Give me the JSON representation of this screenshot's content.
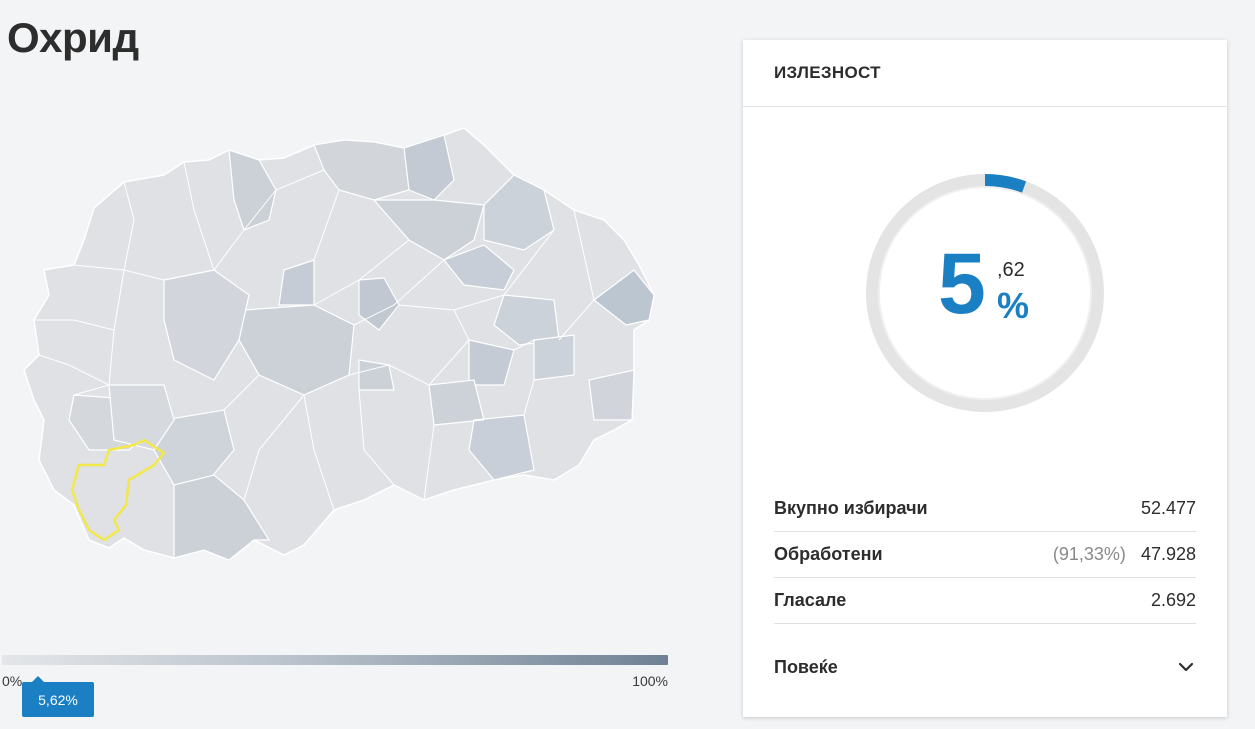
{
  "page": {
    "title": "Охрид"
  },
  "legend": {
    "min_label": "0%",
    "max_label": "100%",
    "marker_label": "5,62%",
    "marker_value_percent": 5.62,
    "gradient_colors": [
      "#e4e6e9",
      "#b8c1cb",
      "#6f8194"
    ]
  },
  "turnout_card": {
    "header": "ИЗЛЕЗНОСТ",
    "gauge": {
      "integer_part": "5",
      "decimal_part": ",62",
      "percent_sign": "%",
      "value_percent": 5.62,
      "accent_color": "#1b7fc3",
      "track_color": "#e4e4e4"
    },
    "stats": [
      {
        "label": "Вкупно избирачи",
        "pct": "",
        "value": "52.477"
      },
      {
        "label": "Обработени",
        "pct": "(91,33%)",
        "value": "47.928"
      },
      {
        "label": "Гласале",
        "pct": "",
        "value": "2.692"
      }
    ],
    "more_label": "Повеќе",
    "more_icon": "chevron-down-icon"
  },
  "map": {
    "highlight_color": "#f3e84a",
    "selected_region": "Охрид"
  }
}
